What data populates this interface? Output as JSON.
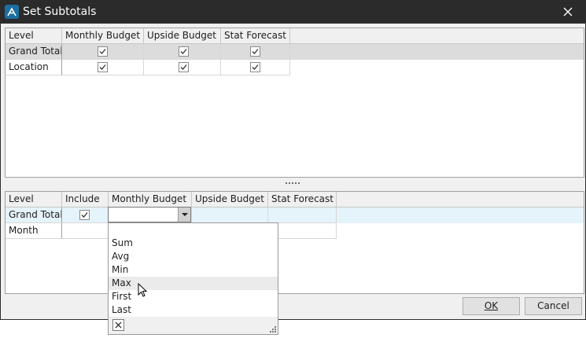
{
  "window": {
    "title": "Set Subtotals"
  },
  "top_grid": {
    "columns": [
      "Level",
      "Monthly Budget",
      "Upside Budget",
      "Stat Forecast"
    ],
    "rows": [
      {
        "level": "Grand Total",
        "checks": [
          true,
          true,
          true
        ],
        "selected": true
      },
      {
        "level": "Location",
        "checks": [
          true,
          true,
          true
        ],
        "selected": false
      }
    ]
  },
  "bottom_grid": {
    "columns": [
      "Level",
      "Include",
      "Monthly Budget",
      "Upside Budget",
      "Stat Forecast"
    ],
    "rows": [
      {
        "level": "Grand Total",
        "include": true,
        "monthly_budget": "",
        "selected": true
      },
      {
        "level": "Month",
        "include": false,
        "monthly_budget": "",
        "selected": false
      }
    ]
  },
  "dropdown": {
    "options": [
      "Sum",
      "Avg",
      "Min",
      "Max",
      "First",
      "Last"
    ],
    "highlighted": "Max"
  },
  "buttons": {
    "ok": "OK",
    "cancel": "Cancel"
  },
  "colors": {
    "titlebar": "#2b2b2b",
    "selected_row": "#dcdcdc",
    "active_row": "#e5f3fb",
    "accent": "#1c6fa0"
  }
}
